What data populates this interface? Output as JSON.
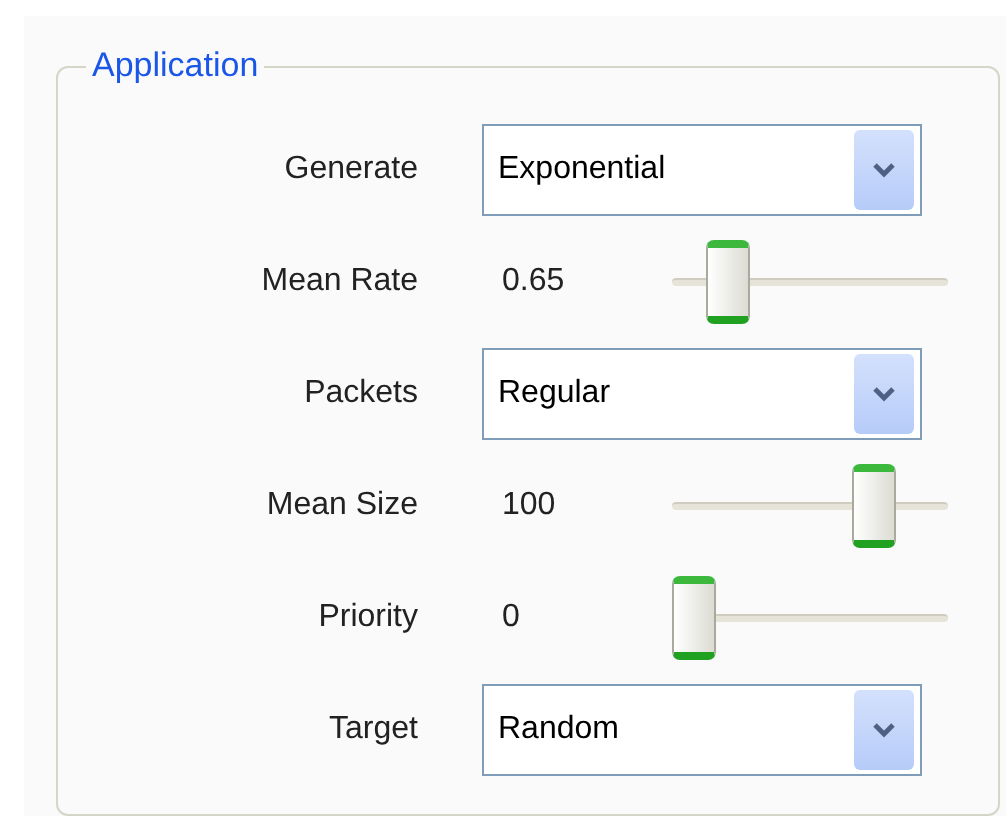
{
  "group": {
    "title": "Application"
  },
  "rows": [
    {
      "kind": "dropdown",
      "label": "Generate",
      "value": "Exponential"
    },
    {
      "kind": "slider",
      "label": "Mean Rate",
      "reading": "0.65",
      "level": 0.15
    },
    {
      "kind": "dropdown",
      "label": "Packets",
      "value": "Regular"
    },
    {
      "kind": "slider",
      "label": "Mean Size",
      "reading": "100",
      "level": 0.78
    },
    {
      "kind": "slider",
      "label": "Priority",
      "reading": "0",
      "level": 0
    },
    {
      "kind": "dropdown",
      "label": "Target",
      "value": "Random"
    }
  ]
}
